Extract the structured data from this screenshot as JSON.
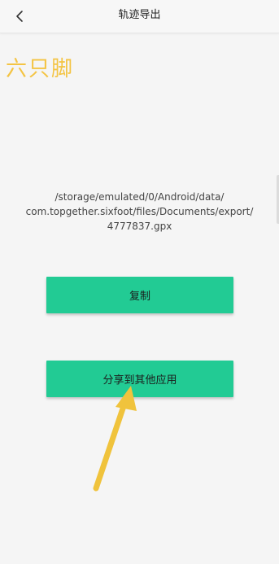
{
  "header": {
    "title": "轨迹导出",
    "back_icon": "chevron-left-icon"
  },
  "logo": {
    "text": "六只脚",
    "color": "#f4c443"
  },
  "export": {
    "path_line1": "/storage/emulated/0/Android/data/",
    "path_line2": "com.topgether.sixfoot/files/Documents/export/",
    "path_line3": "4777837.gpx"
  },
  "buttons": {
    "copy_label": "复制",
    "share_label": "分享到其他应用",
    "color": "#22cb94"
  },
  "annotation": {
    "arrow_icon": "arrow-up-icon",
    "color": "#f0c33c"
  }
}
